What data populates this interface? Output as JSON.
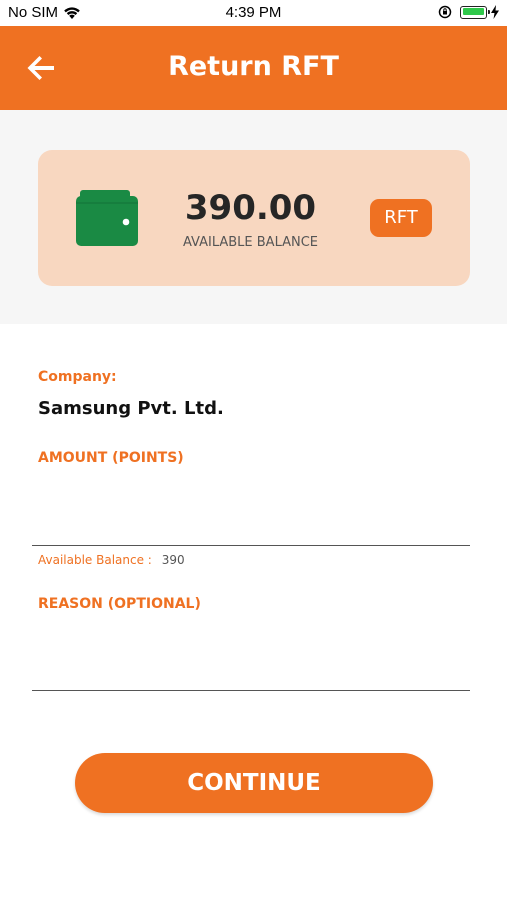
{
  "status_bar": {
    "carrier": "No SIM",
    "time": "4:39 PM",
    "icons": [
      "wifi-icon",
      "orientation-lock-icon",
      "battery-icon",
      "charging-icon"
    ]
  },
  "header": {
    "title": "Return RFT",
    "back_icon": "arrow-left-icon"
  },
  "balance_card": {
    "amount": "390.00",
    "label": "AVAILABLE BALANCE",
    "badge": "RFT",
    "icon": "wallet-icon"
  },
  "form": {
    "company_label": "Company:",
    "company_value": "Samsung Pvt. Ltd.",
    "amount_label": "AMOUNT (POINTS)",
    "amount_value": "",
    "available_label": "Available Balance :",
    "available_value": "390",
    "reason_label": "REASON (OPTIONAL)",
    "reason_value": ""
  },
  "continue_label": "CONTINUE",
  "colors": {
    "accent": "#ef7122",
    "card_background": "#f8d7c0",
    "wallet_green": "#1a8a44"
  }
}
